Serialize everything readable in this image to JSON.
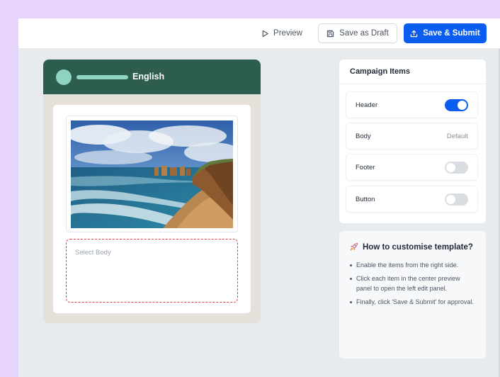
{
  "toolbar": {
    "preview_label": "Preview",
    "draft_label": "Save as Draft",
    "submit_label": "Save & Submit"
  },
  "preview": {
    "language": "English",
    "body_placeholder": "Select Body"
  },
  "campaign_items": {
    "title": "Campaign Items",
    "items": [
      {
        "label": "Header",
        "control": "toggle",
        "enabled": true
      },
      {
        "label": "Body",
        "control": "text",
        "value": "Default"
      },
      {
        "label": "Footer",
        "control": "toggle",
        "enabled": false
      },
      {
        "label": "Button",
        "control": "toggle",
        "enabled": false
      }
    ]
  },
  "help": {
    "icon": "rocket-icon",
    "title": "How to customise template?",
    "steps": [
      "Enable the items from the right side.",
      "Click each item in the center preview panel to open the left edit panel.",
      "Finally, click 'Save & Submit' for approval."
    ]
  },
  "colors": {
    "primary": "#0b5cf0",
    "chat_header": "#2d5d4f",
    "chat_accent": "#8fd3c1",
    "body_border": "#e24040"
  }
}
